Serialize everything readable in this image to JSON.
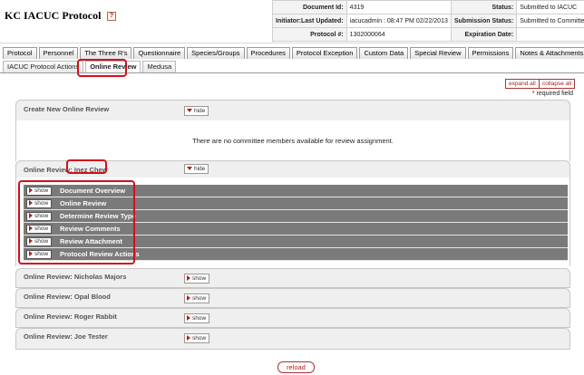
{
  "app_title": "KC IACUC Protocol",
  "help_icon": "?",
  "doc_info": {
    "rows": [
      {
        "l1": "Document Id:",
        "v1": "4319",
        "l2": "Status:",
        "v2": "Submitted to IACUC"
      },
      {
        "l1": "Initiator:Last Updated:",
        "v1": "iacucadmin : 08:47 PM 02/22/2013",
        "l2": "Submission Status:",
        "v2": "Submitted to Committee"
      },
      {
        "l1": "Protocol #:",
        "v1": "1302000064",
        "l2": "Expiration Date:",
        "v2": ""
      }
    ]
  },
  "tabs": [
    "Protocol",
    "Personnel",
    "The Three R's",
    "Questionnaire",
    "Species/Groups",
    "Procedures",
    "Protocol Exception",
    "Custom Data",
    "Special Review",
    "Permissions",
    "Notes & Attachments"
  ],
  "subtabs": [
    "IACUC Protocol Actions",
    "Online Review",
    "Medusa"
  ],
  "active_subtab": "Online Review",
  "expand_all": "expand all",
  "collapse_all": "collapse all",
  "required_field": "* required field",
  "create_panel": {
    "title": "Create New Online Review",
    "hide": "hide",
    "message": "There are no committee members available for review assignment."
  },
  "open_review": {
    "prefix": "Online Review:",
    "name": "Inez Chew",
    "hide": "hide",
    "sections": [
      "Document Overview",
      "Online Review",
      "Determine Review Type",
      "Review Comments",
      "Review Attachment",
      "Protocol Review Actions"
    ],
    "show": "show"
  },
  "collapsed_reviews": [
    {
      "title": "Online Review: Nicholas Majors",
      "show": "show"
    },
    {
      "title": "Online Review: Opal Blood",
      "show": "show"
    },
    {
      "title": "Online Review: Roger Rabbit",
      "show": "show"
    },
    {
      "title": "Online Review: Joe Tester",
      "show": "show"
    }
  ],
  "reload": "reload",
  "colors": {
    "accent_red": "#d0101c",
    "section_gray": "#7a7a7a",
    "panel_gray": "#efefef"
  }
}
